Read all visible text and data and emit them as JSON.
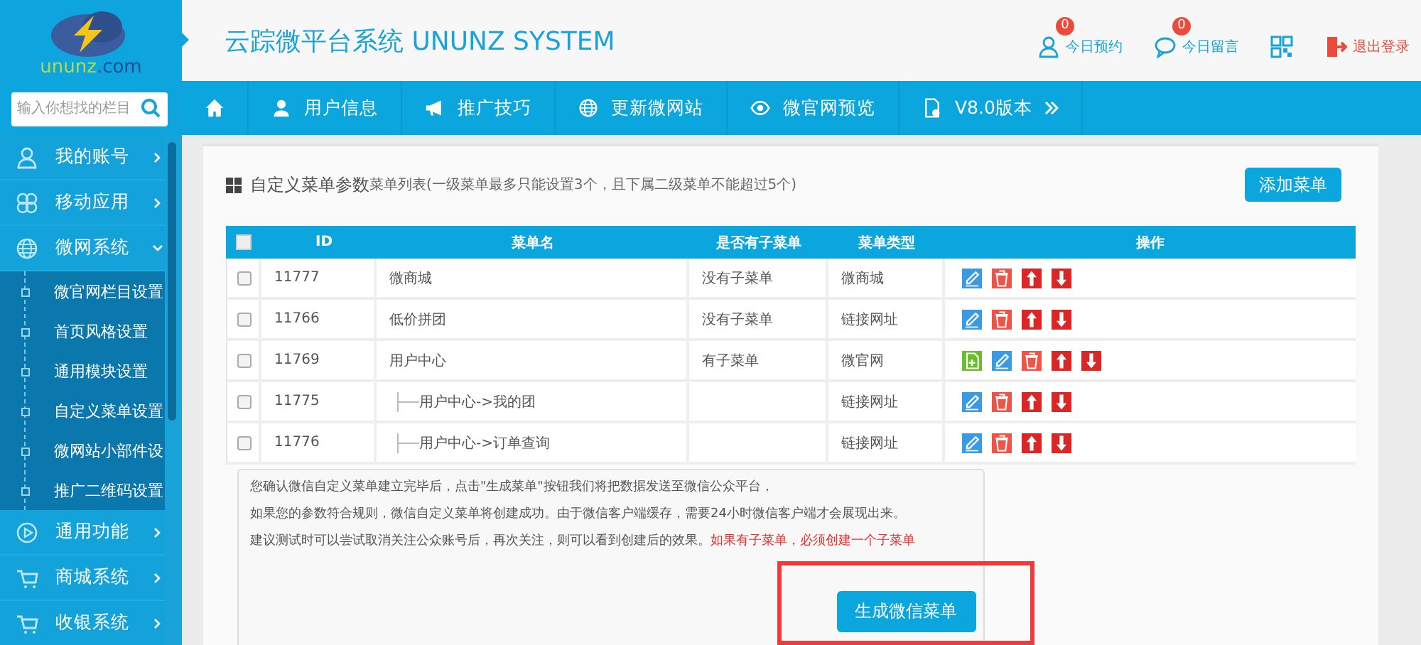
{
  "logo": {
    "text": "ununz",
    "suffix": ".com"
  },
  "header": {
    "title": "云踪微平台系统 UNUNZ SYSTEM",
    "actions": [
      {
        "kind": "person",
        "label": "今日预约",
        "badge": "0"
      },
      {
        "kind": "chat",
        "label": "今日留言",
        "badge": "0"
      },
      {
        "kind": "qr"
      },
      {
        "kind": "logout",
        "label": "退出登录"
      }
    ]
  },
  "search": {
    "placeholder": "输入你想找的栏目"
  },
  "nav": [
    {
      "kind": "home"
    },
    {
      "kind": "user",
      "label": "用户信息"
    },
    {
      "kind": "megaphone",
      "label": "推广技巧"
    },
    {
      "kind": "globe",
      "label": "更新微网站"
    },
    {
      "kind": "eye",
      "label": "微官网预览"
    },
    {
      "kind": "document",
      "label": "V8.0版本"
    }
  ],
  "sidebar": {
    "items": [
      {
        "kind": "person",
        "label": "我的账号",
        "expanded": false
      },
      {
        "kind": "apps",
        "label": "移动应用",
        "expanded": false
      },
      {
        "kind": "globe",
        "label": "微网系统",
        "expanded": true,
        "children": [
          {
            "label": "微官网栏目设置"
          },
          {
            "label": "首页风格设置"
          },
          {
            "label": "通用模块设置"
          },
          {
            "label": "自定义菜单设置"
          },
          {
            "label": "微网站小部件设"
          },
          {
            "label": "推广二维码设置"
          }
        ]
      },
      {
        "kind": "play",
        "label": "通用功能",
        "expanded": false
      },
      {
        "kind": "cart",
        "label": "商城系统",
        "expanded": false
      },
      {
        "kind": "cart",
        "label": "收银系统",
        "expanded": false
      }
    ]
  },
  "panel": {
    "title": "自定义菜单参数",
    "subtitle": "菜单列表(一级菜单最多只能设置3个，且下属二级菜单不能超过5个)",
    "add_button": "添加菜单",
    "table": {
      "select_all_checked": false,
      "columns": [
        "ID",
        "菜单名",
        "是否有子菜单",
        "菜单类型",
        "操作"
      ],
      "rows": [
        {
          "checked": false,
          "id": "11777",
          "name": "微商城",
          "has_sub": "没有子菜单",
          "type": "微商城",
          "actions": [
            {
              "kind": "edit"
            },
            {
              "kind": "delete"
            },
            {
              "kind": "up"
            },
            {
              "kind": "down"
            }
          ]
        },
        {
          "checked": false,
          "id": "11766",
          "name": "低价拼团",
          "has_sub": "没有子菜单",
          "type": "链接网址",
          "actions": [
            {
              "kind": "edit"
            },
            {
              "kind": "delete"
            },
            {
              "kind": "up"
            },
            {
              "kind": "down"
            }
          ]
        },
        {
          "checked": false,
          "id": "11769",
          "name": "用户中心",
          "has_sub": "有子菜单",
          "type": "微官网",
          "actions": [
            {
              "kind": "add"
            },
            {
              "kind": "edit"
            },
            {
              "kind": "delete"
            },
            {
              "kind": "up"
            },
            {
              "kind": "down"
            }
          ],
          "children": [
            {
              "checked": false,
              "id": "11775",
              "name": "用户中心->我的团",
              "type": "链接网址",
              "actions": [
                {
                  "kind": "edit"
                },
                {
                  "kind": "delete"
                },
                {
                  "kind": "up"
                },
                {
                  "kind": "down"
                }
              ]
            },
            {
              "checked": false,
              "id": "11776",
              "name": "用户中心->订单查询",
              "type": "链接网址",
              "actions": [
                {
                  "kind": "edit"
                },
                {
                  "kind": "delete"
                },
                {
                  "kind": "up"
                },
                {
                  "kind": "down"
                }
              ]
            }
          ]
        }
      ]
    },
    "notes": [
      "您确认微信自定义菜单建立完毕后，点击\"生成菜单\"按钮我们将把数据发送至微信公众平台，",
      "如果您的参数符合规则，微信自定义菜单将创建成功。由于微信客户端缓存，需要24小时微信客户端才会展现出来。",
      "建议测试时可以尝试取消关注公众账号后，再次关注，则可以看到创建后的效果。"
    ],
    "warning": "如果有子菜单，必须创建一个子菜单",
    "generate_button": {
      "label": "生成微信菜单",
      "highlighted": true
    }
  }
}
